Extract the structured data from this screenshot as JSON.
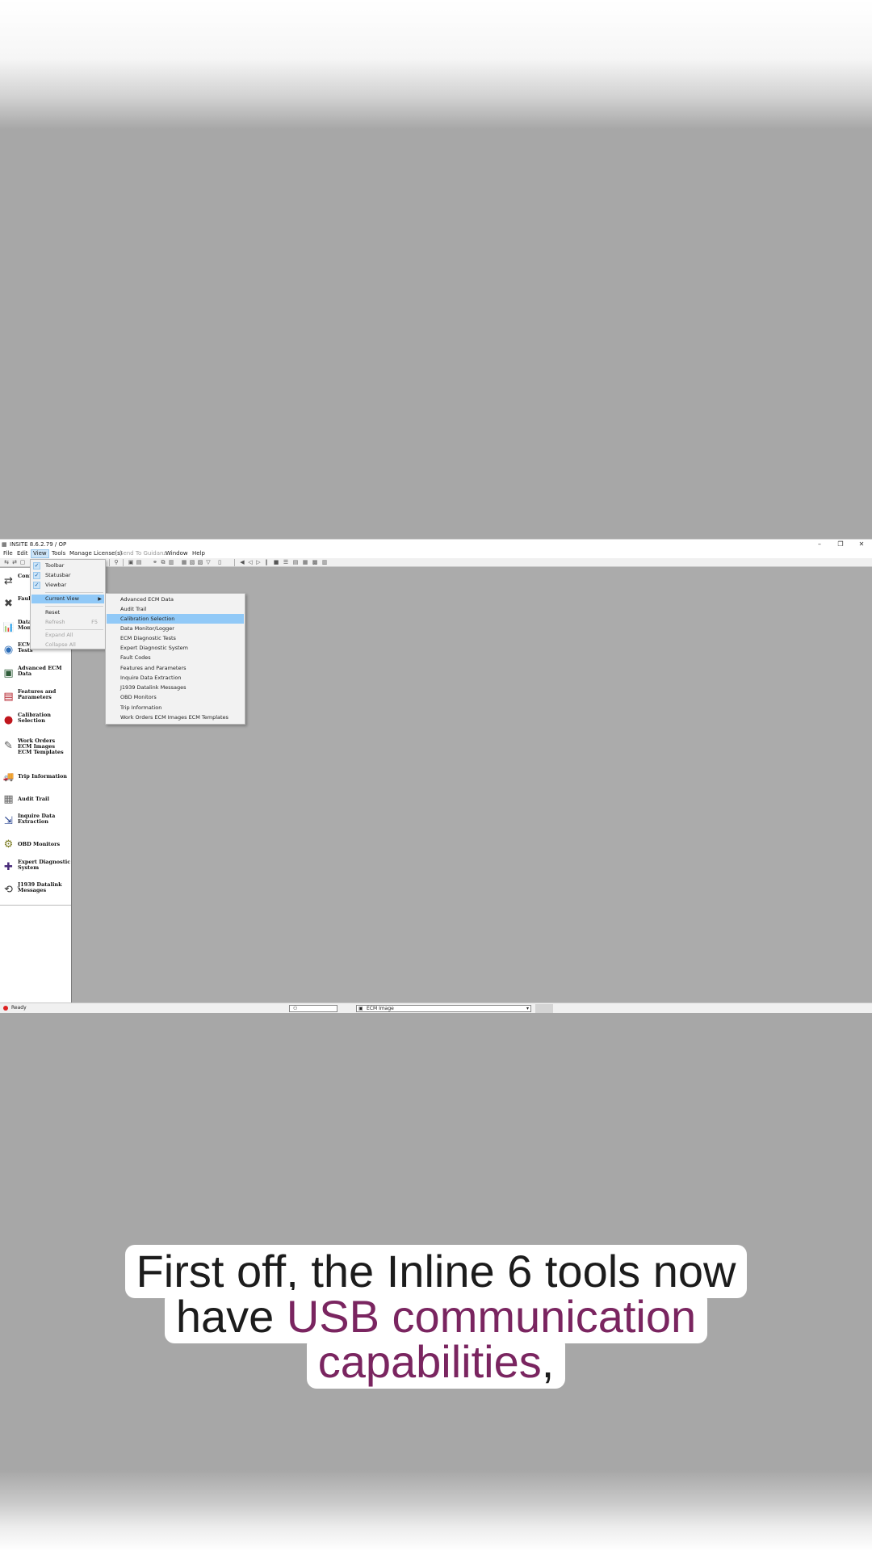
{
  "window": {
    "title": "INSITE 8.6.2.79 / OP",
    "controls": {
      "minimize": "–",
      "maximize": "❐",
      "close": "✕"
    }
  },
  "menubar": [
    "File",
    "Edit",
    "View",
    "Tools",
    "Manage License(s)",
    "Send To Guidanz",
    "Window",
    "Help"
  ],
  "view_menu": {
    "toolbar": "Toolbar",
    "statusbar": "Statusbar",
    "viewbar": "Viewbar",
    "current_view": "Current View",
    "reset": "Reset",
    "refresh": "Refresh",
    "refresh_shortcut": "F5",
    "expand_all": "Expand All",
    "collapse_all": "Collapse All"
  },
  "current_view_submenu": [
    "Advanced ECM Data",
    "Audit Trail",
    "Calibration Selection",
    "Data Monitor/Logger",
    "ECM Diagnostic Tests",
    "Expert Diagnostic System",
    "Fault Codes",
    "Features and Parameters",
    "Inquire Data Extraction",
    "J1939 Datalink Messages",
    "OBD Monitors",
    "Trip Information",
    "Work Orders ECM Images ECM Templates"
  ],
  "sidebar": [
    {
      "label": "Conn",
      "icon": "connection-icon",
      "glyph": "⇄"
    },
    {
      "label": "Fault",
      "icon": "fault-codes-icon",
      "glyph": "✖"
    },
    {
      "label": "Data\nMoni",
      "icon": "data-monitor-icon",
      "glyph": "📊"
    },
    {
      "label": "ECM Diagnostic\nTests",
      "icon": "ecm-diagnostic-icon",
      "glyph": "◉"
    },
    {
      "label": "Advanced ECM\nData",
      "icon": "advanced-ecm-icon",
      "glyph": "▣"
    },
    {
      "label": "Features and\nParameters",
      "icon": "features-parameters-icon",
      "glyph": "▤"
    },
    {
      "label": "Calibration\nSelection",
      "icon": "calibration-icon",
      "glyph": "●"
    },
    {
      "label": "Work Orders\nECM Images\nECM Templates",
      "icon": "work-orders-icon",
      "glyph": "✎"
    },
    {
      "label": "Trip Information",
      "icon": "trip-information-icon",
      "glyph": "🚚"
    },
    {
      "label": "Audit Trail",
      "icon": "audit-trail-icon",
      "glyph": "▦"
    },
    {
      "label": "Inquire Data\nExtraction",
      "icon": "inquire-data-icon",
      "glyph": "⇲"
    },
    {
      "label": "OBD Monitors",
      "icon": "obd-monitors-icon",
      "glyph": "⚙"
    },
    {
      "label": "Expert Diagnostic\nSystem",
      "icon": "expert-diagnostic-icon",
      "glyph": "✚"
    },
    {
      "label": "J1939 Datalink\nMessages",
      "icon": "j1939-datalink-icon",
      "glyph": "⟲"
    }
  ],
  "statusbar": {
    "status": "Ready",
    "selector_value": "ECM Image"
  },
  "caption": {
    "line1": "First off, the Inline 6 tools now",
    "line2_prefix": "have ",
    "line2_accent": "USB communication",
    "line3_accent": "capabilities",
    "line3_suffix": ","
  },
  "colors": {
    "highlight": "#91c9f7",
    "accent_text": "#7a2560",
    "background": "#a7a7a7"
  }
}
